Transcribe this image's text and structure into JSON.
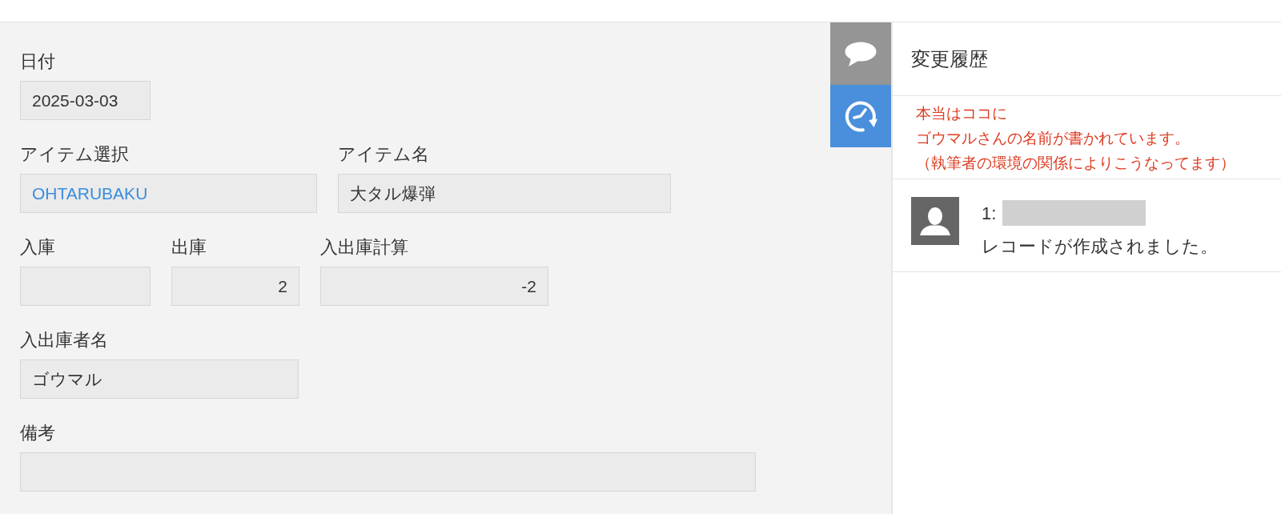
{
  "form": {
    "lines": [
      {
        "fields": [
          {
            "label": "日付",
            "value": "2025-03-03",
            "kind": "date"
          }
        ]
      },
      {
        "fields": [
          {
            "label": "アイテム選択",
            "value": "OHTARUBAKU",
            "kind": "lookup"
          },
          {
            "label": "アイテム名",
            "value": "大タル爆弾",
            "kind": "text"
          }
        ]
      },
      {
        "fields": [
          {
            "label": "入庫",
            "kind": "number"
          },
          {
            "label": "出庫",
            "value": "2",
            "kind": "number"
          },
          {
            "label": "入出庫計算",
            "value": "-2",
            "kind": "number"
          }
        ]
      },
      {
        "fields": [
          {
            "label": "入出庫者名",
            "value": "ゴウマル",
            "kind": "text"
          }
        ]
      },
      {
        "fields": [
          {
            "label": "備考",
            "kind": "note"
          }
        ]
      }
    ]
  },
  "side_tabs": [
    {
      "kind": "comments",
      "selected": false
    },
    {
      "kind": "history",
      "selected": true
    }
  ],
  "history_panel": {
    "title": "変更履歴",
    "note_lines": [
      "本当はココに",
      "ゴウマルさんの名前が書かれています。",
      "（執筆者の環境の関係によりこうなってます）"
    ],
    "entries": [
      {
        "number": "1:",
        "message": "レコードが作成されました。"
      }
    ]
  }
}
